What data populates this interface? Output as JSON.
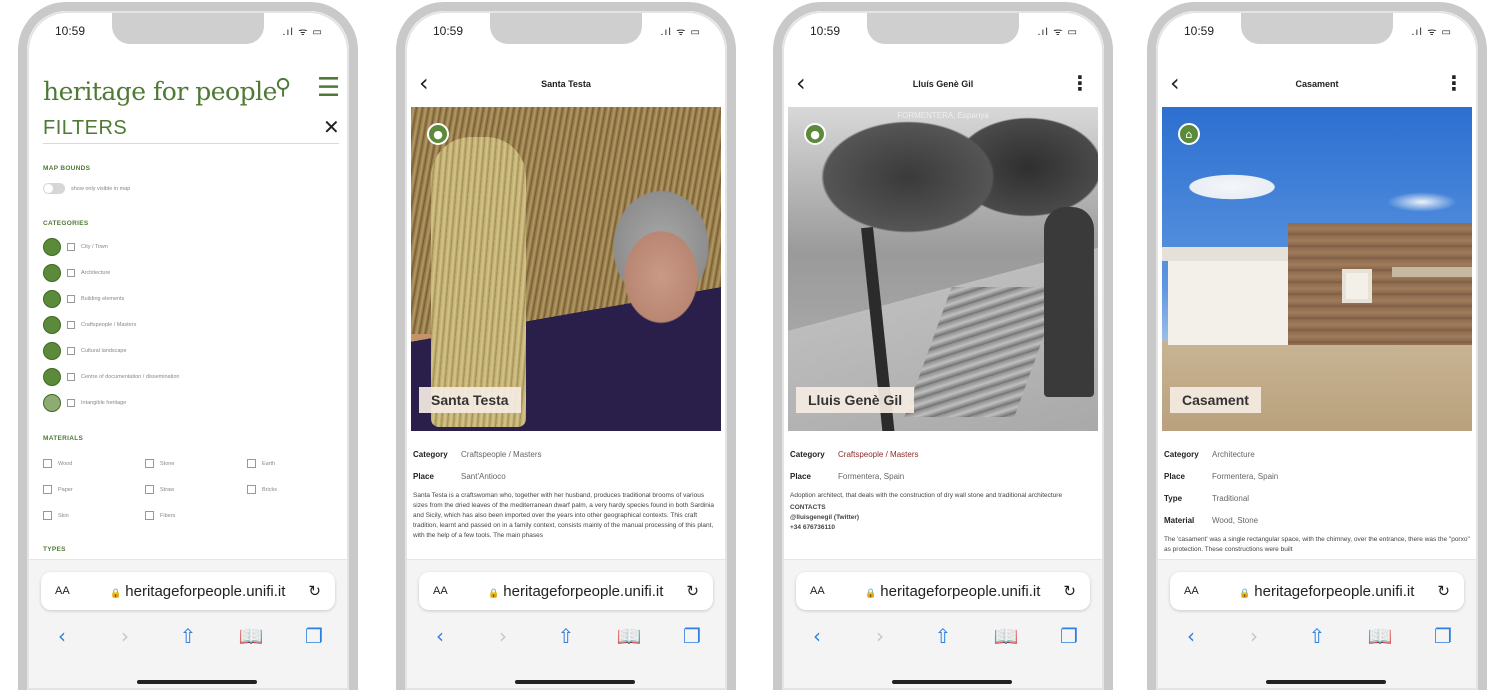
{
  "status": {
    "time": "10:59",
    "icons": ".ıl ᯤ ▭"
  },
  "browser": {
    "aa": "AA",
    "url": "heritageforpeople.unifi.it",
    "lock_icon": "lock-icon",
    "reload_icon": "reload-icon"
  },
  "filters": {
    "logo": "heritage for people",
    "title": "FILTERS",
    "map_bounds_label": "MAP BOUNDS",
    "map_bounds_toggle": "show only visible in map",
    "categories_label": "CATEGORIES",
    "categories": [
      "City / Town",
      "Architecture",
      "Building elements",
      "Craftspeople / Masters",
      "Cultural landscape",
      "Centre of documentation / dissemination",
      "Intangible heritage"
    ],
    "materials_label": "MATERIALS",
    "materials": [
      "Wood",
      "Stone",
      "Earth",
      "Paper",
      "Straw",
      "Bricks",
      "Skin",
      "Fibers"
    ],
    "types_label": "TYPES"
  },
  "santa": {
    "nav_title": "Santa Testa",
    "photo_label": "Santa Testa",
    "category_key": "Category",
    "category_val": "Craftspeople / Masters",
    "place_key": "Place",
    "place_val": "Sant'Antioco",
    "description": "Santa Testa is a craftswoman who, together with her husband, produces traditional brooms of various sizes from the dried leaves of the mediterranean dwarf palm, a very hardy species found in both Sardinia and Sicily, which has also been imported over the years into other geographical contexts. This craft tradition, learnt and passed on in a family context, consists mainly of the manual processing of this plant, with the help of a few tools. The main phases"
  },
  "lluis": {
    "nav_title": "Lluís Genè Gil",
    "photo_label": "Lluis Genè Gil",
    "photo_caption": "FORMENTERA, Espanya",
    "category_key": "Category",
    "category_val": "Craftspeople / Masters",
    "place_key": "Place",
    "place_val": "Formentera, Spain",
    "description": "Adoption architect, that deals with the construction of dry wall stone and traditional architecture",
    "contacts_label": "CONTACTS",
    "twitter": "@lluisgenegil (Twitter)",
    "phone": "+34 676736110"
  },
  "casament": {
    "nav_title": "Casament",
    "photo_label": "Casament",
    "category_key": "Category",
    "category_val": "Architecture",
    "place_key": "Place",
    "place_val": "Formentera, Spain",
    "type_key": "Type",
    "type_val": "Traditional",
    "material_key": "Material",
    "material_val": "Wood, Stone",
    "description": "The 'casament' was a single rectangular space, with the chimney, over the entrance, there was the \"porxo\" as protection. These constructions were built"
  },
  "colors": {
    "brand_green": "#4f7a35",
    "ios_blue": "#2f7fe0"
  }
}
